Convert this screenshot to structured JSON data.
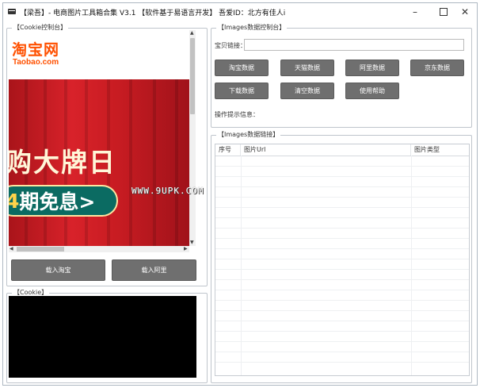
{
  "window": {
    "title": "【梁吾】- 电商图片工具箱合集 V3.1    【软件基于易语言开发】   吾爱ID：北方有佳人i"
  },
  "cookie_panel": {
    "legend": "【Cookie控制台】",
    "browser": {
      "logo_cn": "淘宝网",
      "logo_en": "Taobao.com",
      "banner_text": "购大牌日",
      "pill_num": "4",
      "pill_text": "期免息>"
    },
    "load_taobao_label": "载入淘宝",
    "load_ali_label": "载入阿里"
  },
  "cookie_output": {
    "legend": "【Cookie】"
  },
  "images_control": {
    "legend": "【Images数据控制台】",
    "link_label": "宝贝链接：",
    "link_value": "",
    "buttons": [
      {
        "label": "淘宝数据"
      },
      {
        "label": "天猫数据"
      },
      {
        "label": "阿里数据"
      },
      {
        "label": "京东数据"
      },
      {
        "label": "下载数据"
      },
      {
        "label": "清空数据"
      },
      {
        "label": "使用帮助"
      }
    ],
    "hint_label": "操作提示信息："
  },
  "images_links": {
    "legend": "【Images数据链接】",
    "columns": [
      "序号",
      "图片Url",
      "图片类型"
    ]
  },
  "watermark": "WWW.9UPK.COM",
  "colors": {
    "button_bg": "#6f6f6f",
    "taobao_orange": "#ff5000",
    "banner_red": "#d8222a"
  }
}
